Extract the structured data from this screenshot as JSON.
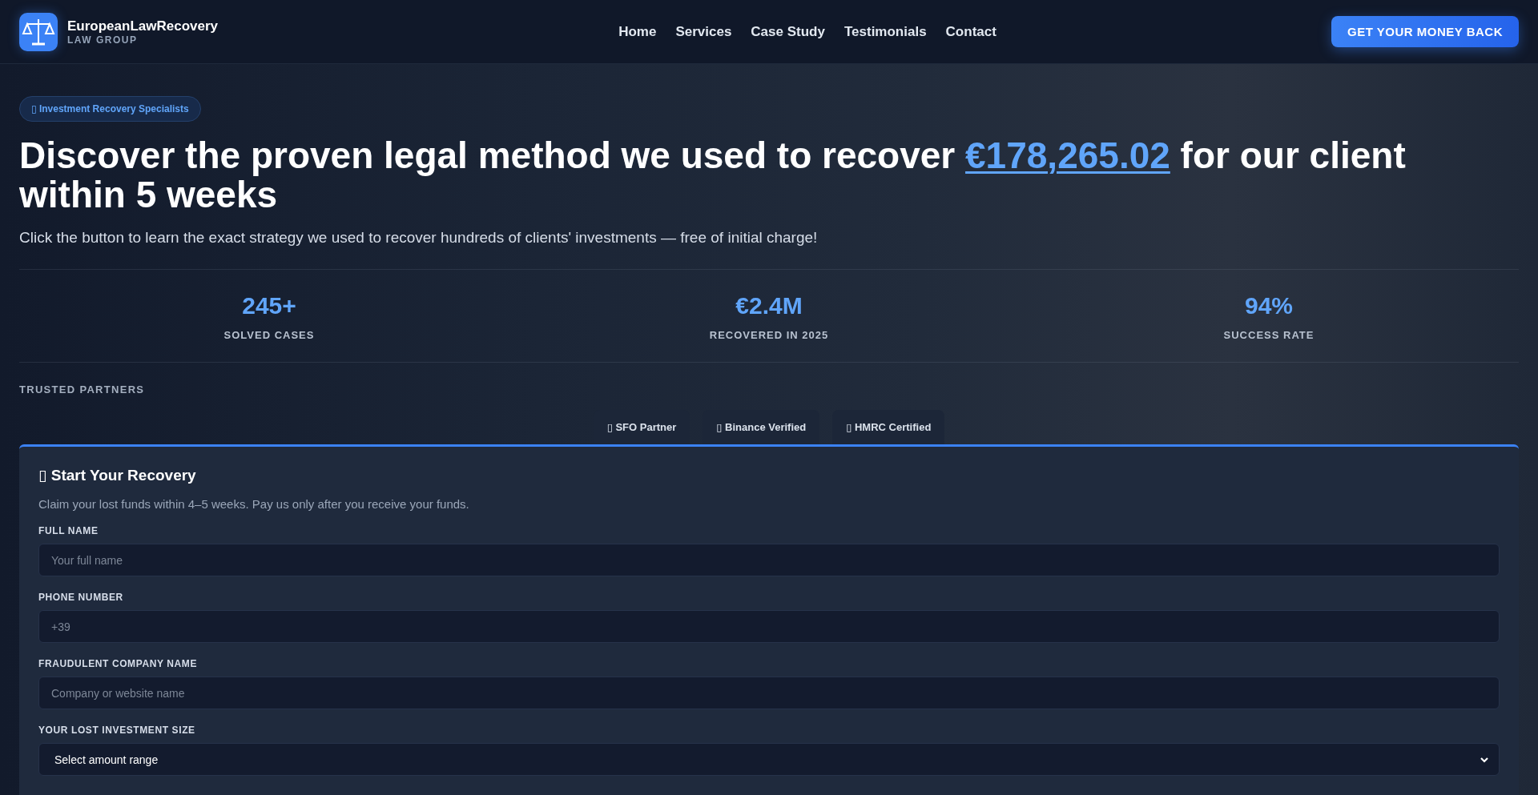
{
  "brand": {
    "name": "EuropeanLawRecovery",
    "tagline": "LAW GROUP"
  },
  "nav": [
    "Home",
    "Services",
    "Case Study",
    "Testimonials",
    "Contact"
  ],
  "cta": "GET YOUR MONEY BACK",
  "hero": {
    "badge": "▯ Investment Recovery Specialists",
    "headline_before": "Discover the proven legal method we used to recover ",
    "headline_amount": "€178,265.02",
    "headline_after": " for our client within 5 weeks",
    "subtitle": "Click the button to learn the exact strategy we used to recover hundreds of clients' investments — free of initial charge!"
  },
  "stats": [
    {
      "value": "245+",
      "label": "SOLVED CASES"
    },
    {
      "value": "€2.4M",
      "label": "RECOVERED IN 2025"
    },
    {
      "value": "94%",
      "label": "SUCCESS RATE"
    }
  ],
  "partners": {
    "heading": "TRUSTED PARTNERS",
    "items": [
      "▯ SFO Partner",
      "▯ Binance Verified",
      "▯ HMRC Certified"
    ]
  },
  "form": {
    "title": "▯ Start Your Recovery",
    "description": "Claim your lost funds within 4–5 weeks. Pay us only after you receive your funds.",
    "fields": [
      {
        "kind": "input",
        "label": "FULL NAME",
        "placeholder": "Your full name"
      },
      {
        "kind": "input",
        "label": "PHONE NUMBER",
        "placeholder": "+39"
      },
      {
        "kind": "input",
        "label": "FRAUDULENT COMPANY NAME",
        "placeholder": "Company or website name"
      },
      {
        "kind": "select",
        "label": "YOUR LOST INVESTMENT SIZE",
        "value": "Select amount range"
      }
    ]
  }
}
